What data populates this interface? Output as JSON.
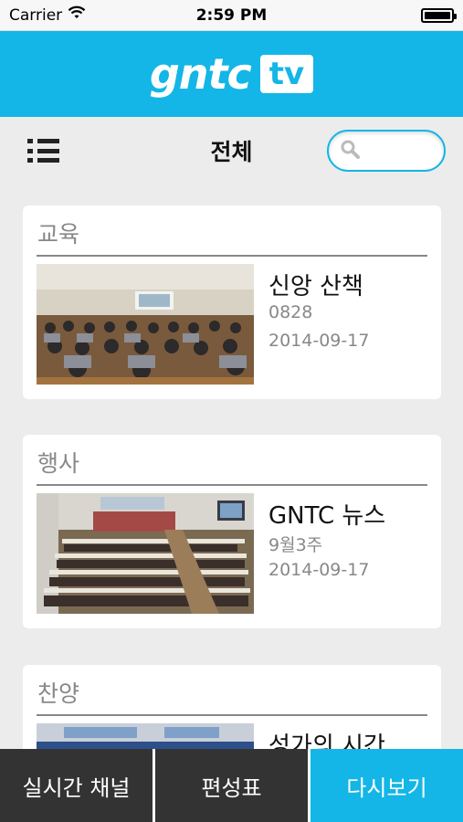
{
  "status_bar": {
    "carrier": "Carrier",
    "time": "2:59 PM"
  },
  "header": {
    "logo_text": "gntc",
    "logo_badge": "tv"
  },
  "toolbar": {
    "title": "전체",
    "search_placeholder": ""
  },
  "cards": [
    {
      "category": "교육",
      "title": "신앙 산책",
      "subtitle": "0828",
      "date": "2014-09-17"
    },
    {
      "category": "행사",
      "title": "GNTC 뉴스",
      "subtitle": "9월3주",
      "date": "2014-09-17"
    },
    {
      "category": "찬양",
      "title": "성가의 시간",
      "subtitle": "",
      "date": ""
    }
  ],
  "tabs": [
    {
      "label": "실시간 채널"
    },
    {
      "label": "편성표"
    },
    {
      "label": "다시보기"
    }
  ],
  "colors": {
    "accent": "#13b6e6",
    "tab_dark": "#333333",
    "background": "#ececec"
  }
}
